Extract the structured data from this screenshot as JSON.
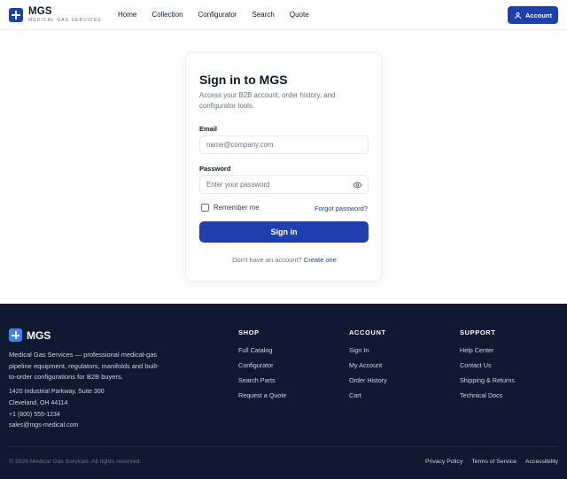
{
  "brand": {
    "name": "MGS",
    "tagline": "MEDICAL GAS SERVICES",
    "color": "#1e40af"
  },
  "nav": {
    "items": [
      {
        "label": "Home"
      },
      {
        "label": "Collection"
      },
      {
        "label": "Configurator"
      },
      {
        "label": "Search"
      },
      {
        "label": "Quote"
      }
    ]
  },
  "header": {
    "account_label": "Account",
    "account_icon": "user-icon"
  },
  "signin": {
    "title": "Sign in to MGS",
    "subtitle": "Access your B2B account, order history, and configurator tools.",
    "email_label": "Email",
    "email_placeholder": "name@company.com",
    "email_value": "",
    "password_label": "Password",
    "password_placeholder": "Enter your password",
    "password_value": "",
    "password_toggle_icon": "eye-icon",
    "remember_label": "Remember me",
    "remember_checked": false,
    "forgot_label": "Forgot password?",
    "submit_label": "Sign in",
    "no_account_text": "Don't have an account?",
    "create_label": "Create one"
  },
  "footer": {
    "brand_name": "MGS",
    "description": "Medical Gas Services — professional medical-gas pipeline equipment, regulators, manifolds and built-to-order configurations for B2B buyers.",
    "address_line1": "1420 Industrial Parkway, Suite 300",
    "address_line2": "Cleveland, OH 44114",
    "phone": "+1 (800) 555-1234",
    "email": "sales@mgs-medical.com",
    "columns": [
      {
        "title": "SHOP",
        "links": [
          "Full Catalog",
          "Configurator",
          "Search Parts",
          "Request a Quote"
        ]
      },
      {
        "title": "ACCOUNT",
        "links": [
          "Sign In",
          "My Account",
          "Order History",
          "Cart"
        ]
      },
      {
        "title": "SUPPORT",
        "links": [
          "Help Center",
          "Contact Us",
          "Shipping & Returns",
          "Technical Docs"
        ]
      }
    ],
    "copyright": "© 2026 Medical Gas Services. All rights reserved.",
    "legal": [
      "Privacy Policy",
      "Terms of Service",
      "Accessibility"
    ],
    "background": "#0f1930"
  }
}
